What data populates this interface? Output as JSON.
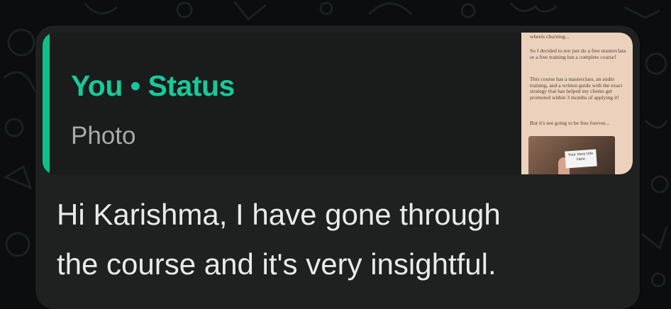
{
  "reply_quote": {
    "sender": "You",
    "separator": "•",
    "source": "Status",
    "title": "You • Status",
    "media_type": "Photo",
    "thumbnail": {
      "lines": [
        "wheels churning...",
        "So I decided to not just do a free masterclass or a free training but a complete course!",
        "This course has a masterclass, an audio training, and a written guide with the exact strategy that has helped my clients get promoted within 3 months of applying it!",
        "But it's not going to be free forever..."
      ],
      "card_text": "Your Here Info Here"
    }
  },
  "message": {
    "line1": "Hi Karishma, I have gone through",
    "line2": "the course and it's very insightful."
  },
  "colors": {
    "accent": "#17c99a",
    "quote_bar": "#0cc089",
    "bubble": "#1f2020",
    "background": "#0b0d0e"
  }
}
